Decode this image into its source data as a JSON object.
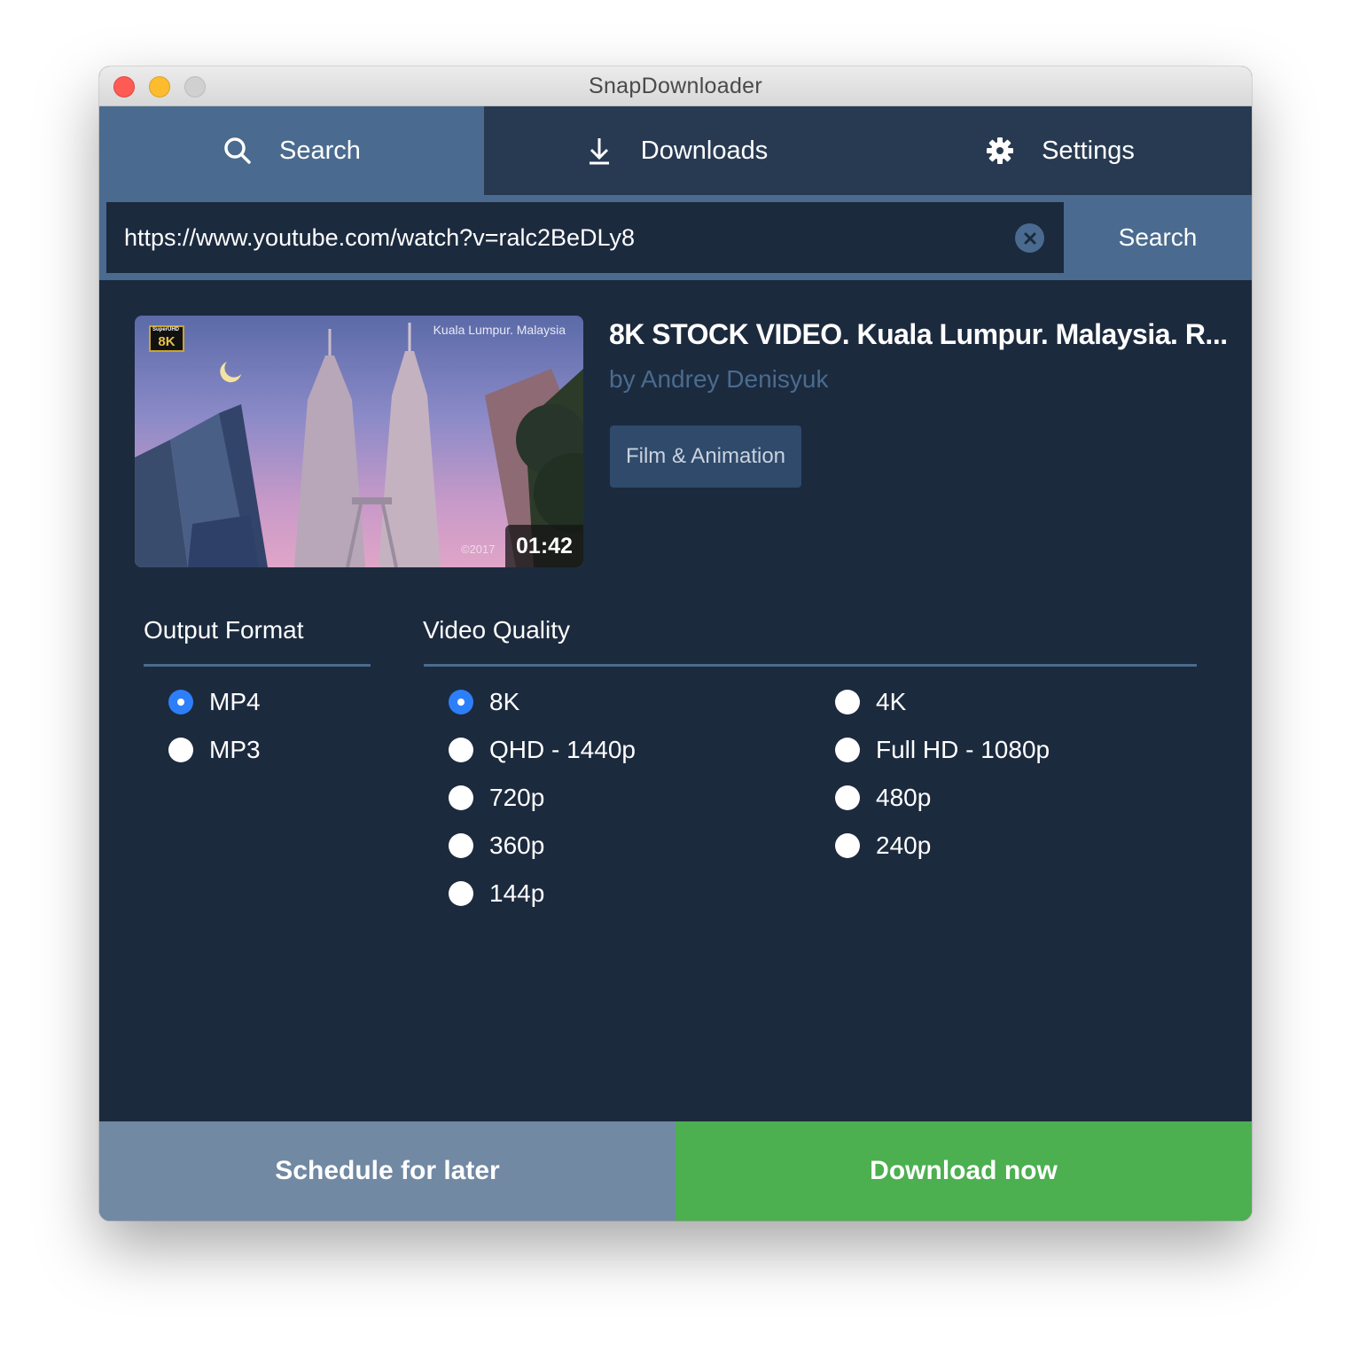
{
  "window": {
    "title": "SnapDownloader"
  },
  "tabs": [
    {
      "label": "Search",
      "icon": "search-icon",
      "active": true
    },
    {
      "label": "Downloads",
      "icon": "download-icon",
      "active": false
    },
    {
      "label": "Settings",
      "icon": "gear-icon",
      "active": false
    }
  ],
  "search": {
    "url_value": "https://www.youtube.com/watch?v=ralc2BeDLy8",
    "button_label": "Search"
  },
  "video": {
    "title": "8K STOCK VIDEO. Kuala Lumpur. Malaysia. R...",
    "author": "by Andrey Denisyuk",
    "category": "Film & Animation",
    "duration": "01:42",
    "thumbnail_caption": "Kuala Lumpur. Malaysia",
    "thumbnail_badge": "8K",
    "thumbnail_badge_small": "SuperUHD",
    "thumbnail_copyright": "©2017"
  },
  "output_format": {
    "label": "Output Format",
    "options": [
      {
        "label": "MP4",
        "selected": true
      },
      {
        "label": "MP3",
        "selected": false
      }
    ]
  },
  "video_quality": {
    "label": "Video Quality",
    "options": [
      {
        "label": "8K",
        "selected": true
      },
      {
        "label": "4K",
        "selected": false
      },
      {
        "label": "QHD - 1440p",
        "selected": false
      },
      {
        "label": "Full HD - 1080p",
        "selected": false
      },
      {
        "label": "720p",
        "selected": false
      },
      {
        "label": "480p",
        "selected": false
      },
      {
        "label": "360p",
        "selected": false
      },
      {
        "label": "240p",
        "selected": false
      },
      {
        "label": "144p",
        "selected": false
      }
    ]
  },
  "actions": {
    "schedule_label": "Schedule for later",
    "download_label": "Download now"
  },
  "colors": {
    "accent_blue": "#4a6b8f",
    "background_dark": "#1c2a3e",
    "tab_bar": "#283a52",
    "download_green": "#4caf50",
    "schedule_gray": "#7189a3",
    "radio_selected": "#2d7ff9"
  }
}
